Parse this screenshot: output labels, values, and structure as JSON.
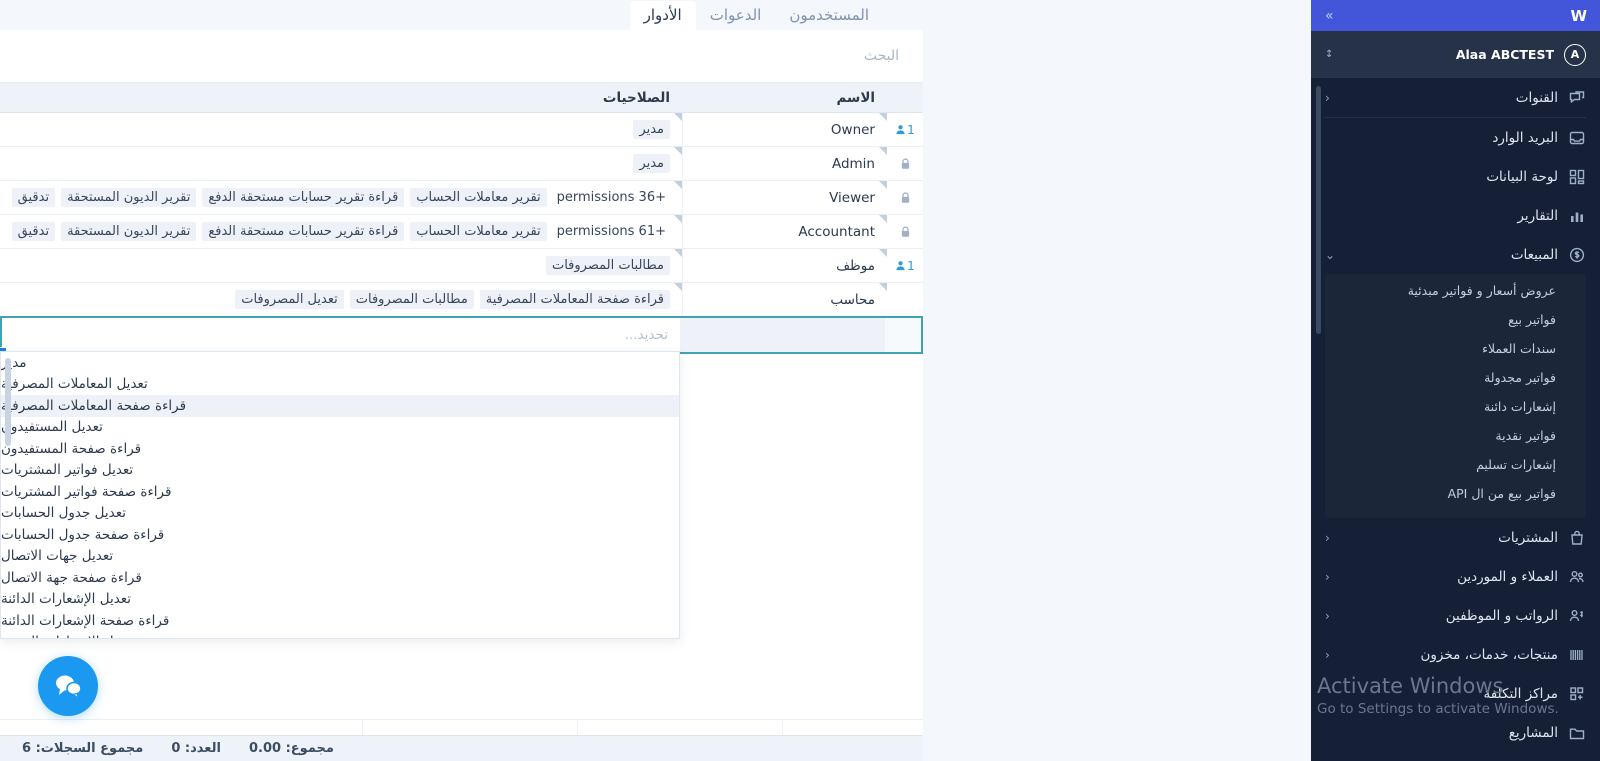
{
  "tabs": [
    {
      "label": "المستخدمون",
      "active": false
    },
    {
      "label": "الدعوات",
      "active": false
    },
    {
      "label": "الأدوار",
      "active": true
    }
  ],
  "search": {
    "placeholder": "البحث",
    "value": ""
  },
  "table": {
    "headers": {
      "name": "الاسم",
      "permissions": "الصلاحيات"
    },
    "rows": [
      {
        "icon": "people-count-icon",
        "count": "1",
        "name": "Owner",
        "perms": [
          "مدير"
        ],
        "more": ""
      },
      {
        "icon": "lock-icon",
        "count": "",
        "name": "Admin",
        "perms": [
          "مدير"
        ],
        "more": ""
      },
      {
        "icon": "lock-icon",
        "count": "",
        "name": "Viewer",
        "perms": [
          "تقرير معاملات الحساب",
          "قراءة تقرير حسابات مستحقة الدفع",
          "تقرير الديون المستحقة",
          "تدقيق"
        ],
        "more": "+36 permissions"
      },
      {
        "icon": "lock-icon",
        "count": "",
        "name": "Accountant",
        "perms": [
          "تقرير معاملات الحساب",
          "قراءة تقرير حسابات مستحقة الدفع",
          "تقرير الديون المستحقة",
          "تدقيق"
        ],
        "more": "+61 permissions"
      },
      {
        "icon": "people-count-icon",
        "count": "1",
        "name": "موظف",
        "perms": [
          "مطالبات المصروفات"
        ],
        "more": ""
      },
      {
        "icon": "",
        "count": "",
        "name": "محاسب",
        "perms": [
          "قراءة صفحة المعاملات المصرفية",
          "مطالبات المصروفات",
          "تعديل المصروفات"
        ],
        "more": ""
      }
    ],
    "new_row": {
      "name_value": "",
      "perms_placeholder": "تحديد..."
    }
  },
  "dropdown": {
    "items": [
      {
        "label": "مدير",
        "highlighted": false
      },
      {
        "label": "تعديل المعاملات المصرفية",
        "highlighted": false
      },
      {
        "label": "قراءة صفحة المعاملات المصرفية",
        "highlighted": true
      },
      {
        "label": "تعديل المستفيدون",
        "highlighted": false
      },
      {
        "label": "قراءة صفحة المستفيدون",
        "highlighted": false
      },
      {
        "label": "تعديل فواتير المشتريات",
        "highlighted": false
      },
      {
        "label": "قراءة صفحة فواتير المشتريات",
        "highlighted": false
      },
      {
        "label": "تعديل جدول الحسابات",
        "highlighted": false
      },
      {
        "label": "قراءة صفحة جدول الحسابات",
        "highlighted": false
      },
      {
        "label": "تعديل جهات الاتصال",
        "highlighted": false
      },
      {
        "label": "قراءة صفحة جهة الاتصال",
        "highlighted": false
      },
      {
        "label": "تعديل الإشعارات الدائنة",
        "highlighted": false
      },
      {
        "label": "قراءة صفحة الإشعارات الدائنة",
        "highlighted": false
      },
      {
        "label": "تعديل الإشعارات المدينة",
        "highlighted": false
      }
    ]
  },
  "footer": {
    "records_total": "مجموع السجلات: 6",
    "count": "العدد: 0",
    "sum": "مجموع: 0.00"
  },
  "chat": {
    "icon": "chat-bubbles-icon"
  },
  "sidebar": {
    "logo": "W",
    "expand_icon": "chevron-double-right-icon",
    "account": {
      "initial": "A",
      "name": "Alaa ABCTEST",
      "caret_icon": "chevron-updown-icon"
    },
    "items": [
      {
        "label": "القنوات",
        "icon": "channels-icon",
        "chevron": "‹",
        "expanded": false
      },
      {
        "label": "البريد الوارد",
        "icon": "inbox-icon",
        "chevron": "",
        "expanded": false
      },
      {
        "label": "لوحة البيانات",
        "icon": "dashboard-icon",
        "chevron": "",
        "expanded": false
      },
      {
        "label": "التقارير",
        "icon": "reports-icon",
        "chevron": "",
        "expanded": false
      },
      {
        "label": "المبيعات",
        "icon": "sales-icon",
        "chevron": "⌄",
        "expanded": true
      },
      {
        "label": "المشتريات",
        "icon": "purchases-icon",
        "chevron": "‹",
        "expanded": false
      },
      {
        "label": "العملاء و الموردين",
        "icon": "customers-icon",
        "chevron": "‹",
        "expanded": false
      },
      {
        "label": "الرواتب و الموظفين",
        "icon": "payroll-icon",
        "chevron": "‹",
        "expanded": false
      },
      {
        "label": "منتجات، خدمات، مخزون",
        "icon": "inventory-icon",
        "chevron": "‹",
        "expanded": false
      },
      {
        "label": "مراكز التكلفة",
        "icon": "cost-centers-icon",
        "chevron": "",
        "expanded": false
      },
      {
        "label": "المشاريع",
        "icon": "projects-icon",
        "chevron": "",
        "expanded": false
      }
    ],
    "sales_submenu": [
      "عروض أسعار و فواتير مبدئية",
      "فواتير بيع",
      "سندات العملاء",
      "فواتير مجدولة",
      "إشعارات دائنة",
      "فواتير نقدية",
      "إشعارات تسليم",
      "فواتير بيع من ال API"
    ]
  },
  "watermark": {
    "title": "Activate Windows",
    "subtitle": "Go to Settings to activate Windows."
  },
  "colors": {
    "brand_blue": "#4355d8",
    "sidebar_bg": "#152036",
    "accent_teal": "#41a2b5",
    "chat_blue": "#1b98f0"
  }
}
